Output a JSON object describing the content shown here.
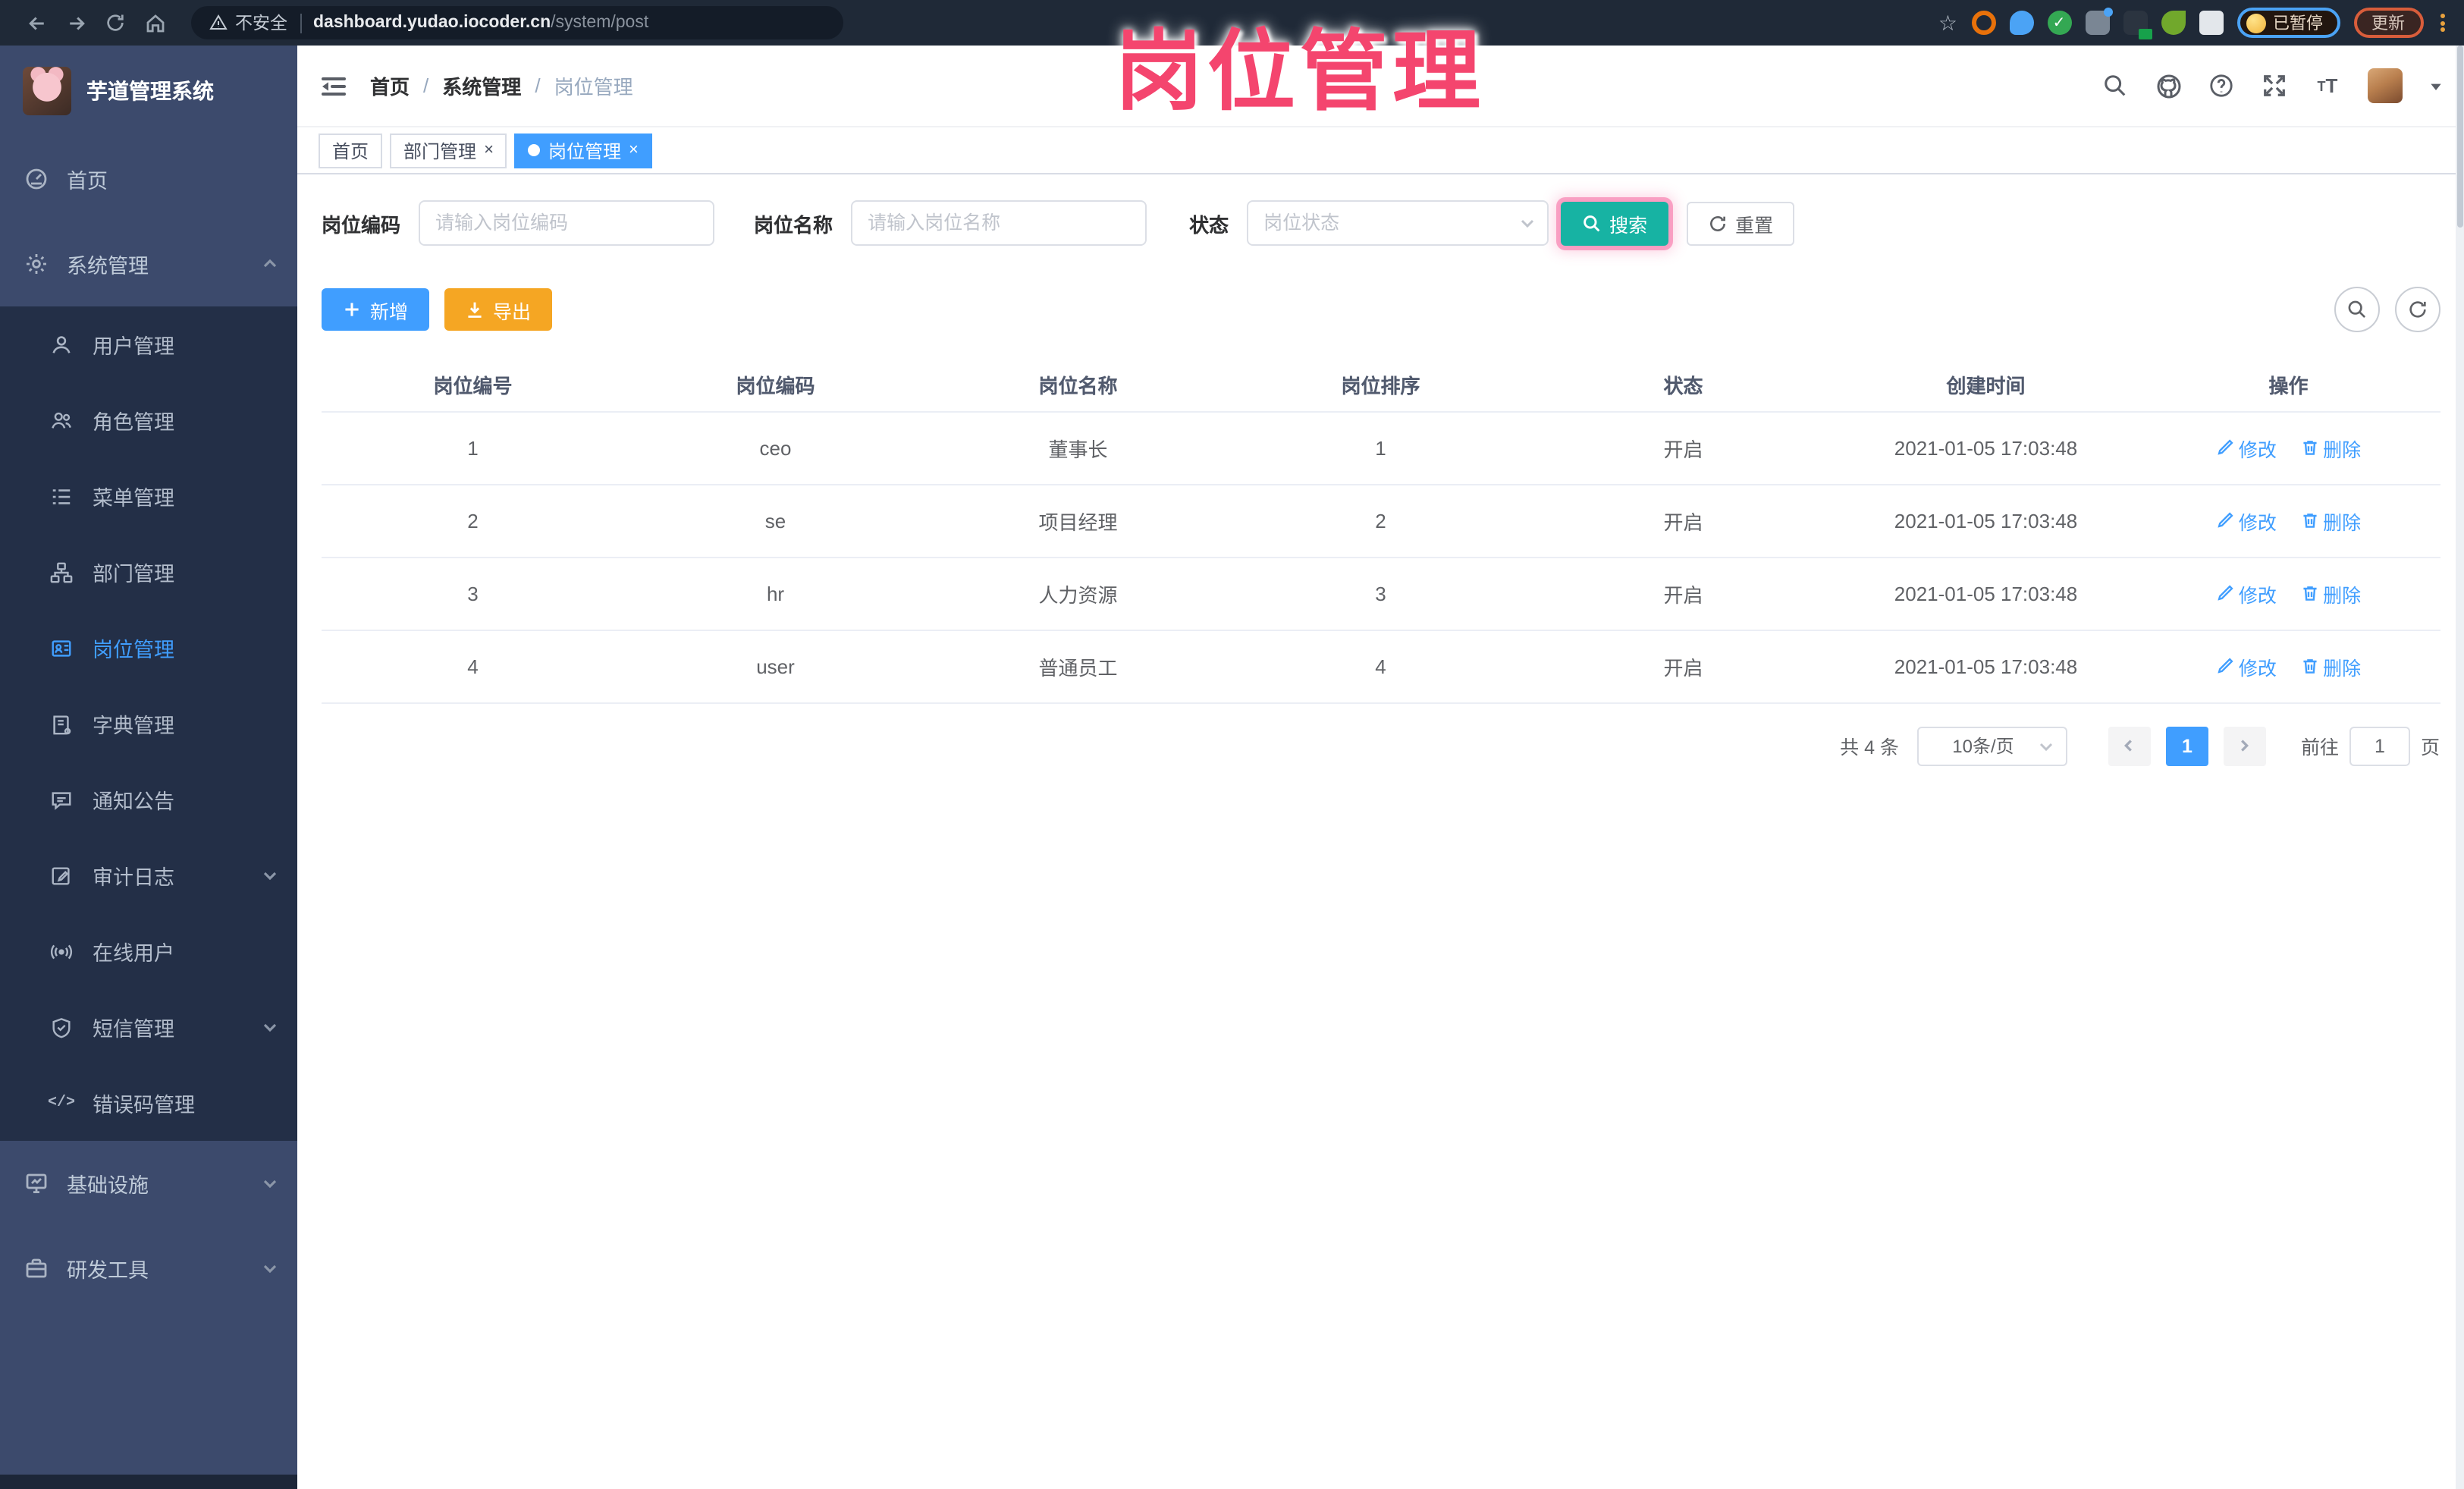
{
  "browser": {
    "security_label": "不安全",
    "url_host": "dashboard.yudao.iocoder.cn",
    "url_path": "/system/post",
    "paused_badge": "已暂停",
    "update_button": "更新"
  },
  "annotation": {
    "title": "岗位管理",
    "color": "#F4456E"
  },
  "sidebar": {
    "app_title": "芋道管理系统",
    "items": [
      {
        "label": "首页",
        "icon": "dashboard-icon",
        "level": "top"
      },
      {
        "label": "系统管理",
        "icon": "gear-icon",
        "level": "top",
        "expanded": true
      },
      {
        "label": "用户管理",
        "icon": "user-icon",
        "level": "sub"
      },
      {
        "label": "角色管理",
        "icon": "roles-icon",
        "level": "sub"
      },
      {
        "label": "菜单管理",
        "icon": "menu-list-icon",
        "level": "sub"
      },
      {
        "label": "部门管理",
        "icon": "org-tree-icon",
        "level": "sub"
      },
      {
        "label": "岗位管理",
        "icon": "post-badge-icon",
        "level": "sub",
        "active": true
      },
      {
        "label": "字典管理",
        "icon": "dict-book-icon",
        "level": "sub"
      },
      {
        "label": "通知公告",
        "icon": "message-icon",
        "level": "sub"
      },
      {
        "label": "审计日志",
        "icon": "log-icon",
        "level": "sub",
        "collapsible": true
      },
      {
        "label": "在线用户",
        "icon": "online-icon",
        "level": "sub"
      },
      {
        "label": "短信管理",
        "icon": "sms-shield-icon",
        "level": "sub",
        "collapsible": true
      },
      {
        "label": "错误码管理",
        "icon": "code-icon",
        "level": "sub"
      },
      {
        "label": "基础设施",
        "icon": "monitor-icon",
        "level": "top",
        "collapsible": true
      },
      {
        "label": "研发工具",
        "icon": "toolbox-icon",
        "level": "top",
        "collapsible": true
      }
    ]
  },
  "header": {
    "breadcrumb": [
      "首页",
      "系统管理",
      "岗位管理"
    ],
    "separator": "/"
  },
  "tabs": [
    {
      "label": "首页"
    },
    {
      "label": "部门管理"
    },
    {
      "label": "岗位管理"
    }
  ],
  "filters": {
    "post_code_label": "岗位编码",
    "post_code_placeholder": "请输入岗位编码",
    "post_name_label": "岗位名称",
    "post_name_placeholder": "请输入岗位名称",
    "status_label": "状态",
    "status_placeholder": "岗位状态",
    "search_label": "搜索",
    "reset_label": "重置"
  },
  "toolbar": {
    "add_label": "新增",
    "export_label": "导出"
  },
  "table": {
    "headers": [
      "岗位编号",
      "岗位编码",
      "岗位名称",
      "岗位排序",
      "状态",
      "创建时间",
      "操作"
    ],
    "rows": [
      {
        "id": "1",
        "code": "ceo",
        "name": "董事长",
        "sort": "1",
        "status": "开启",
        "created": "2021-01-05 17:03:48"
      },
      {
        "id": "2",
        "code": "se",
        "name": "项目经理",
        "sort": "2",
        "status": "开启",
        "created": "2021-01-05 17:03:48"
      },
      {
        "id": "3",
        "code": "hr",
        "name": "人力资源",
        "sort": "3",
        "status": "开启",
        "created": "2021-01-05 17:03:48"
      },
      {
        "id": "4",
        "code": "user",
        "name": "普通员工",
        "sort": "4",
        "status": "开启",
        "created": "2021-01-05 17:03:48"
      }
    ],
    "actions": {
      "edit": "修改",
      "delete": "删除"
    }
  },
  "pagination": {
    "total": "共 4 条",
    "page_size": "10条/页",
    "current_page": "1",
    "goto_label": "前往",
    "goto_value": "1",
    "page_unit": "页"
  },
  "icons": {
    "close": "×"
  },
  "colors": {
    "primary": "#409EFF",
    "search_teal": "#17B3A3",
    "export_orange": "#F5A623",
    "sidebar_bg": "#3C4A6C",
    "submenu_bg": "#232F47",
    "annotation_pink": "#F4456E"
  }
}
